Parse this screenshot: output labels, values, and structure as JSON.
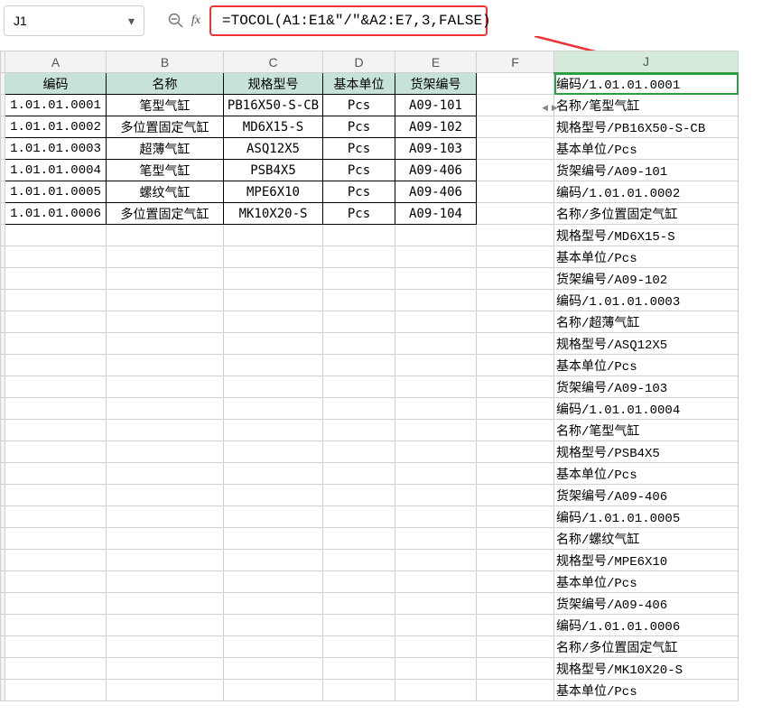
{
  "namebox": {
    "cell_ref": "J1",
    "chevron": "▾"
  },
  "fx": {
    "label": "fx"
  },
  "formula": "=TOCOL(A1:E1&\"/\"&A2:E7,3,FALSE)",
  "col_headers": [
    "A",
    "B",
    "C",
    "D",
    "E",
    "F",
    "J"
  ],
  "source": {
    "headers": [
      "编码",
      "名称",
      "规格型号",
      "基本单位",
      "货架编号"
    ],
    "rows": [
      [
        "1.01.01.0001",
        "笔型气缸",
        "PB16X50-S-CB",
        "Pcs",
        "A09-101"
      ],
      [
        "1.01.01.0002",
        "多位置固定气缸",
        "MD6X15-S",
        "Pcs",
        "A09-102"
      ],
      [
        "1.01.01.0003",
        "超薄气缸",
        "ASQ12X5",
        "Pcs",
        "A09-103"
      ],
      [
        "1.01.01.0004",
        "笔型气缸",
        "PSB4X5",
        "Pcs",
        "A09-406"
      ],
      [
        "1.01.01.0005",
        "螺纹气缸",
        "MPE6X10",
        "Pcs",
        "A09-406"
      ],
      [
        "1.01.01.0006",
        "多位置固定气缸",
        "MK10X20-S",
        "Pcs",
        "A09-104"
      ]
    ]
  },
  "result_col": [
    "编码/1.01.01.0001",
    "名称/笔型气缸",
    "规格型号/PB16X50-S-CB",
    "基本单位/Pcs",
    "货架编号/A09-101",
    "编码/1.01.01.0002",
    "名称/多位置固定气缸",
    "规格型号/MD6X15-S",
    "基本单位/Pcs",
    "货架编号/A09-102",
    "编码/1.01.01.0003",
    "名称/超薄气缸",
    "规格型号/ASQ12X5",
    "基本单位/Pcs",
    "货架编号/A09-103",
    "编码/1.01.01.0004",
    "名称/笔型气缸",
    "规格型号/PSB4X5",
    "基本单位/Pcs",
    "货架编号/A09-406",
    "编码/1.01.01.0005",
    "名称/螺纹气缸",
    "规格型号/MPE6X10",
    "基本单位/Pcs",
    "货架编号/A09-406",
    "编码/1.01.01.0006",
    "名称/多位置固定气缸",
    "规格型号/MK10X20-S",
    "基本单位/Pcs"
  ]
}
